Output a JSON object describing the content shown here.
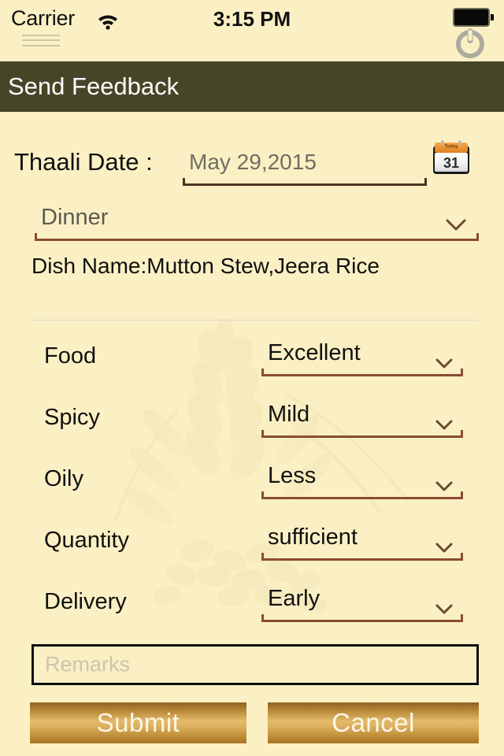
{
  "statusbar": {
    "carrier": "Carrier",
    "time": "3:15 PM",
    "wifi_icon": "wifi-icon",
    "battery_icon": "battery-full-icon",
    "power_icon": "power-button-icon"
  },
  "titlebar": {
    "title": "Send Feedback",
    "background": "#474528"
  },
  "form": {
    "date_label": "Thaali Date :",
    "date_value": "May 29,2015",
    "calendar_icon": "calendar-icon",
    "calendar_icon_day": "31",
    "calendar_icon_header": "Today",
    "meal_value": "Dinner",
    "dish_name": "Dish Name:Mutton Stew,Jeera Rice",
    "remarks_placeholder": "Remarks",
    "ratings": [
      {
        "label": "Food",
        "value": "Excellent"
      },
      {
        "label": "Spicy",
        "value": "Mild"
      },
      {
        "label": "Oily",
        "value": "Less"
      },
      {
        "label": "Quantity",
        "value": "sufficient"
      },
      {
        "label": "Delivery",
        "value": "Early"
      }
    ]
  },
  "buttons": {
    "submit": "Submit",
    "cancel": "Cancel"
  },
  "colors": {
    "background": "#FBF0C4",
    "header": "#474528",
    "underline_brown": "#8A4C32",
    "underline_dark": "#4A3222",
    "button_gold": "#D3A451",
    "text_primary": "#111111",
    "text_muted": "#6F6E63"
  }
}
